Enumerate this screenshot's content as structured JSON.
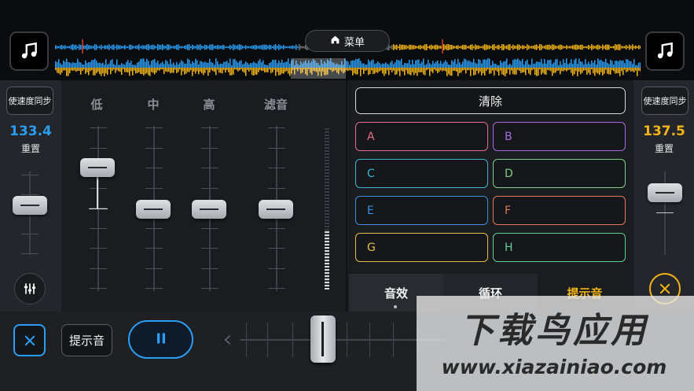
{
  "header": {
    "menu_label": "菜单",
    "left_deck_icon": "music-note-icon",
    "right_deck_icon": "music-note-icon",
    "home_icon": "home-icon"
  },
  "colors": {
    "deck_left": "#2a9df4",
    "deck_right": "#f2b418",
    "accent_blue": "#2a9df4",
    "accent_yellow": "#f2b418"
  },
  "left_deck": {
    "sync_label": "使速度同步",
    "bpm": "133.4",
    "reset_label": "重置",
    "tools_icon": "sliders-icon"
  },
  "right_deck": {
    "sync_label": "使速度同步",
    "bpm": "137.5",
    "reset_label": "重置",
    "close_icon": "close-circle-icon"
  },
  "mixer": {
    "eq_labels": [
      "低",
      "中",
      "高",
      "滤音"
    ]
  },
  "pads": {
    "clear_label": "清除",
    "items": [
      {
        "label": "A",
        "color": "#e86a8c"
      },
      {
        "label": "B",
        "color": "#a86ae0"
      },
      {
        "label": "C",
        "color": "#3ab6d4"
      },
      {
        "label": "D",
        "color": "#7fcf8a"
      },
      {
        "label": "E",
        "color": "#3c8ee0"
      },
      {
        "label": "F",
        "color": "#e0785a"
      },
      {
        "label": "G",
        "color": "#e2c04a"
      },
      {
        "label": "H",
        "color": "#5fcf9a"
      }
    ]
  },
  "tabs": [
    {
      "label": "音效"
    },
    {
      "label": "循环"
    },
    {
      "label": "提示音"
    }
  ],
  "transport": {
    "close_icon": "close-icon",
    "cue_label": "提示音",
    "pause_icon": "pause-icon",
    "prev_icon": "chevron-left-icon"
  },
  "watermark": {
    "title": "下载鸟应用",
    "url": "www.xiazainiao.com"
  }
}
